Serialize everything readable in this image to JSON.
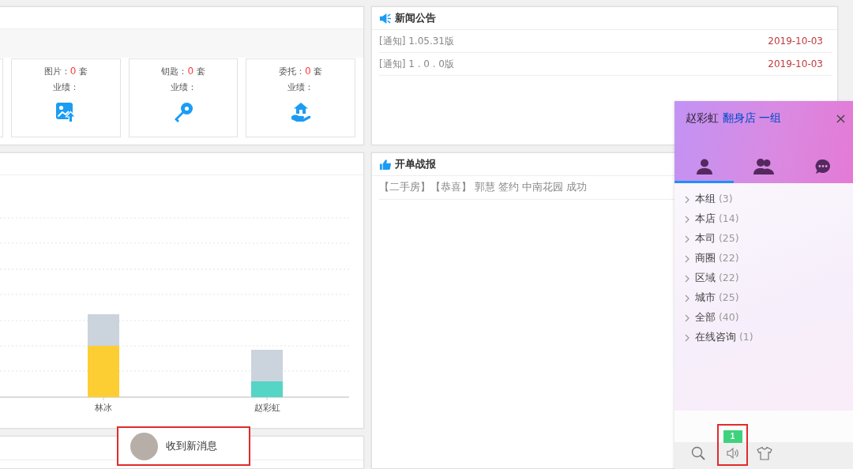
{
  "stat_panel": {
    "cards": [
      {
        "kind": "image",
        "label": "图片：",
        "count": "0",
        "unit": "套",
        "performance": "业绩："
      },
      {
        "kind": "key",
        "label": "钥匙：",
        "count": "0",
        "unit": "套",
        "performance": "业绩："
      },
      {
        "kind": "entrust",
        "label": "委托：",
        "count": "0",
        "unit": "套",
        "performance": "业绩："
      }
    ]
  },
  "ranking_chart": {
    "bars": [
      {
        "label": "林冰",
        "color": "#fdce34"
      },
      {
        "label": "赵彩虹",
        "color": "#55d5c5"
      }
    ]
  },
  "notification": {
    "text": "收到新消息",
    "highlighted": true
  },
  "news": {
    "title": "新闻公告",
    "items": [
      {
        "text": "[通知] 1.05.31版",
        "date": "2019-10-03"
      },
      {
        "text": "[通知] 1 . 0 . 0版",
        "date": "2019-10-03"
      }
    ]
  },
  "reports": {
    "title": "开单战报",
    "items": [
      "【二手房】【恭喜】 郭慧 签约 中南花园 成功"
    ]
  },
  "chat": {
    "user": "赵彩虹",
    "group": "翻身店 一组",
    "tabs": [
      {
        "kind": "person",
        "selected": true
      },
      {
        "kind": "group",
        "selected": false
      },
      {
        "kind": "chat",
        "selected": false
      }
    ],
    "contacts": [
      {
        "name": "本组",
        "count": "(3)",
        "expanded": false
      },
      {
        "name": "本店",
        "count": "(14)",
        "expanded": false
      },
      {
        "name": "本司",
        "count": "(25)",
        "expanded": false
      },
      {
        "name": "商圈",
        "count": "(22)",
        "expanded": false
      },
      {
        "name": "区域",
        "count": "(22)",
        "expanded": false
      },
      {
        "name": "城市",
        "count": "(25)",
        "expanded": false
      },
      {
        "name": "全部",
        "count": "(40)",
        "expanded": false
      },
      {
        "name": "在线咨询",
        "count": "(1)",
        "expanded": false
      }
    ],
    "toolbar": [
      {
        "kind": "search",
        "highlighted": false
      },
      {
        "kind": "speaker",
        "badge": "1",
        "highlighted": true
      },
      {
        "kind": "shirt",
        "highlighted": false
      }
    ]
  }
}
